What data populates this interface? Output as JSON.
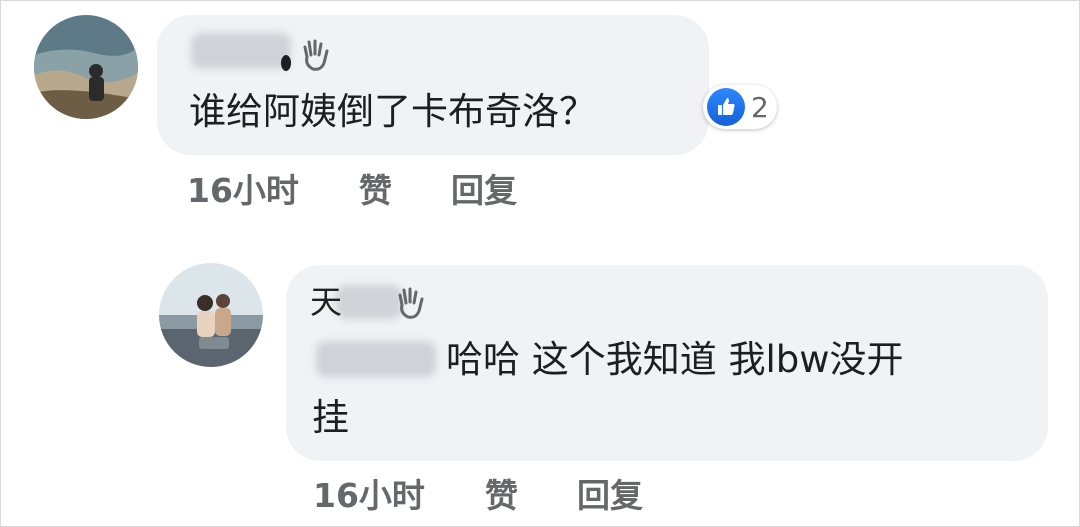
{
  "comments": [
    {
      "author_blurred": true,
      "text": "谁给阿姨倒了卡布奇洛？",
      "reaction": {
        "icon": "like-icon",
        "count": "2"
      },
      "time": "16小时",
      "like_label": "赞",
      "reply_label": "回复"
    },
    {
      "author_blurred": true,
      "author_visible_fragment": "天",
      "text_line1": "哈哈 这个我知道 我lbw没开",
      "text_line2": "挂",
      "time": "16小时",
      "like_label": "赞",
      "reply_label": "回复"
    }
  ],
  "colors": {
    "bubble": "#f0f2f5",
    "text": "#1c1e21",
    "meta": "#65676b",
    "like_blue": "#1877f2"
  }
}
